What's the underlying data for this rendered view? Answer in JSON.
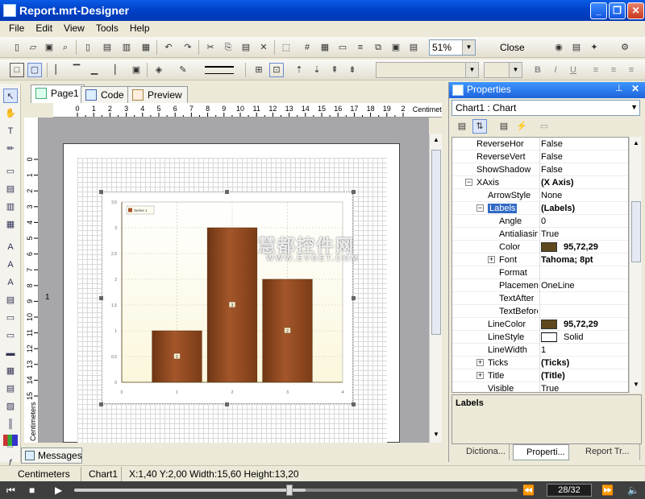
{
  "window": {
    "title": "Report.mrt-Designer"
  },
  "menu": [
    "File",
    "Edit",
    "View",
    "Tools",
    "Help"
  ],
  "toolbar": {
    "zoom": "51%",
    "close_label": "Close"
  },
  "doc_tabs": [
    {
      "label": "Page1"
    },
    {
      "label": "Code"
    },
    {
      "label": "Preview"
    }
  ],
  "ruler": {
    "unit": "Centimeters",
    "h_ticks": [
      "0",
      "1",
      "2",
      "3",
      "4",
      "5",
      "6",
      "7",
      "8",
      "9",
      "10",
      "11",
      "12",
      "13",
      "14",
      "15",
      "16",
      "17",
      "18",
      "19",
      "2"
    ],
    "v_marker": "1",
    "h_marker": "1",
    "v_unit": "Centimeters",
    "v_ticks": [
      "0",
      "1",
      "2",
      "3",
      "4",
      "5",
      "6",
      "7",
      "8",
      "9",
      "10",
      "11",
      "12",
      "13",
      "14",
      "15"
    ]
  },
  "chart_data": {
    "type": "bar",
    "categories": [
      "1",
      "2",
      "3"
    ],
    "values": [
      1,
      3,
      2
    ],
    "value_labels": [
      "1",
      "3",
      "2"
    ],
    "x_ticks": [
      "0",
      "1",
      "2",
      "3",
      "4"
    ],
    "y_ticks": [
      "0",
      "0,5",
      "1",
      "1,5",
      "2",
      "2,5",
      "3",
      "3,5"
    ],
    "ylim": [
      0,
      3.5
    ],
    "xlim": [
      0,
      4
    ],
    "grid": true,
    "legend_placement": "top-left",
    "legend_label": "Series 1",
    "bar_color": "#A4562A",
    "plot_bg": "#FBF7DC"
  },
  "properties": {
    "title": "Properties",
    "object": "Chart1 : Chart",
    "rows": [
      {
        "name": "ReverseHor",
        "value": "False",
        "indent": 0
      },
      {
        "name": "ReverseVert",
        "value": "False",
        "indent": 0
      },
      {
        "name": "ShowShadow",
        "value": "False",
        "indent": 0
      },
      {
        "name": "XAxis",
        "value": "(X Axis)",
        "indent": 0,
        "expander": "−",
        "bold": true
      },
      {
        "name": "ArrowStyle",
        "value": "None",
        "indent": 1
      },
      {
        "name": "Labels",
        "value": "(Labels)",
        "indent": 1,
        "expander": "−",
        "bold": true,
        "selected": true
      },
      {
        "name": "Angle",
        "value": "0",
        "indent": 2
      },
      {
        "name": "Antialiasing",
        "value": "True",
        "indent": 2
      },
      {
        "name": "Color",
        "value": "95,72,29",
        "indent": 2,
        "swatch": "#5F481D",
        "bold": true
      },
      {
        "name": "Font",
        "value": "Tahoma; 8pt",
        "indent": 2,
        "expander": "+",
        "bold": true
      },
      {
        "name": "Format",
        "value": "",
        "indent": 2
      },
      {
        "name": "Placement",
        "value": "OneLine",
        "indent": 2
      },
      {
        "name": "TextAfter",
        "value": "",
        "indent": 2
      },
      {
        "name": "TextBefore",
        "value": "",
        "indent": 2
      },
      {
        "name": "LineColor",
        "value": "95,72,29",
        "indent": 1,
        "swatch": "#5F481D",
        "bold": true
      },
      {
        "name": "LineStyle",
        "value": "Solid",
        "indent": 1,
        "linestyle": true
      },
      {
        "name": "LineWidth",
        "value": "1",
        "indent": 1
      },
      {
        "name": "Ticks",
        "value": "(Ticks)",
        "indent": 1,
        "expander": "+",
        "bold": true
      },
      {
        "name": "Title",
        "value": "(Title)",
        "indent": 1,
        "expander": "+",
        "bold": true
      },
      {
        "name": "Visible",
        "value": "True",
        "indent": 1
      }
    ],
    "description": "Labels",
    "tabs": [
      "Dictiona...",
      "Properti...",
      "Report Tr..."
    ]
  },
  "messages_tab": "Messages",
  "status": {
    "unit": "Centimeters",
    "component": "Chart1",
    "info": "X:1,40 Y:2,00 Width:15,60 Height:13,20"
  },
  "player": {
    "page_count": "28/32",
    "progress": 0.87
  },
  "watermark": {
    "line1": "慧都控件网",
    "line2": "WWW.EVGET.COM"
  }
}
